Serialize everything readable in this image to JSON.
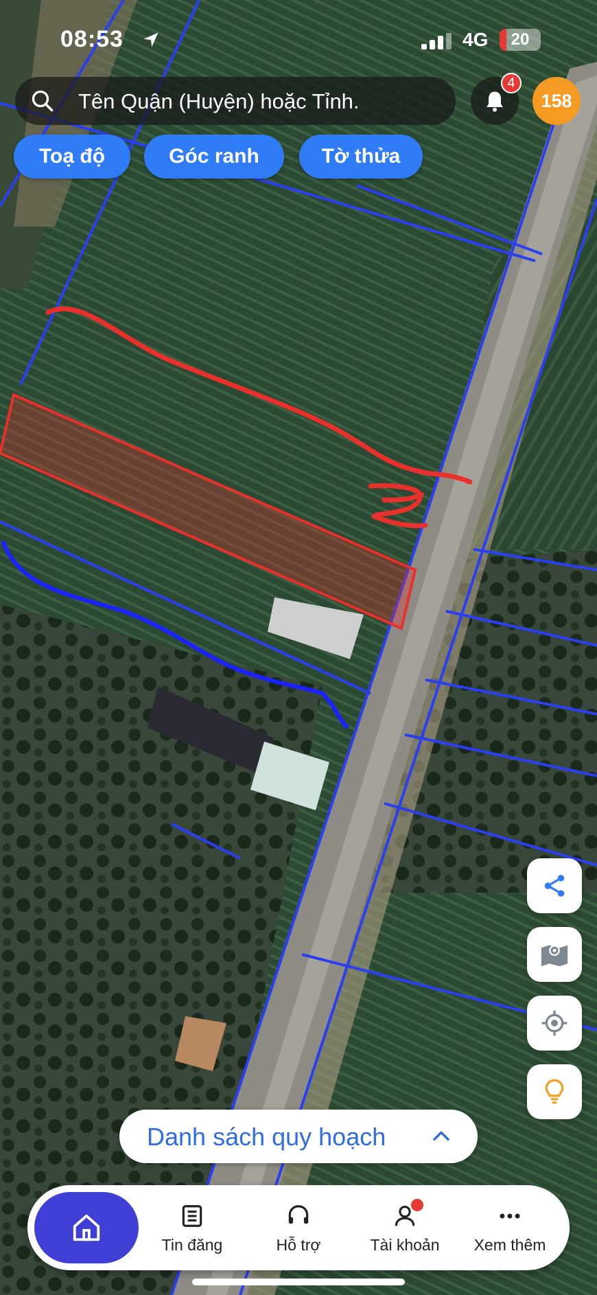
{
  "status_bar": {
    "time": "08:53",
    "network": "4G",
    "battery": "20"
  },
  "search": {
    "placeholder": "Tên Quận (Huyện) hoặc Tỉnh."
  },
  "notifications": {
    "count": "4"
  },
  "points": {
    "value": "158"
  },
  "chips": [
    {
      "label": "Toạ độ"
    },
    {
      "label": "Góc ranh"
    },
    {
      "label": "Tờ thửa"
    }
  ],
  "map": {
    "type": "satellite",
    "parcel_line_color": "#2a3ff0",
    "highlight_color": "#e8302c",
    "annotation_blue": "#1a22ff"
  },
  "fab_icons": [
    "share-icon",
    "map-layers-icon",
    "my-location-icon",
    "lightbulb-icon"
  ],
  "planning_list": {
    "label": "Danh sách quy hoạch"
  },
  "tabbar": {
    "items": [
      {
        "label": "Tin đăng"
      },
      {
        "label": "Hỗ trợ"
      },
      {
        "label": "Tài khoản"
      },
      {
        "label": "Xem thêm"
      }
    ]
  },
  "colors": {
    "accent": "#2f7cf6",
    "home_tab": "#3f3fd6",
    "points_badge": "#f59a23",
    "badge_red": "#e53935"
  }
}
